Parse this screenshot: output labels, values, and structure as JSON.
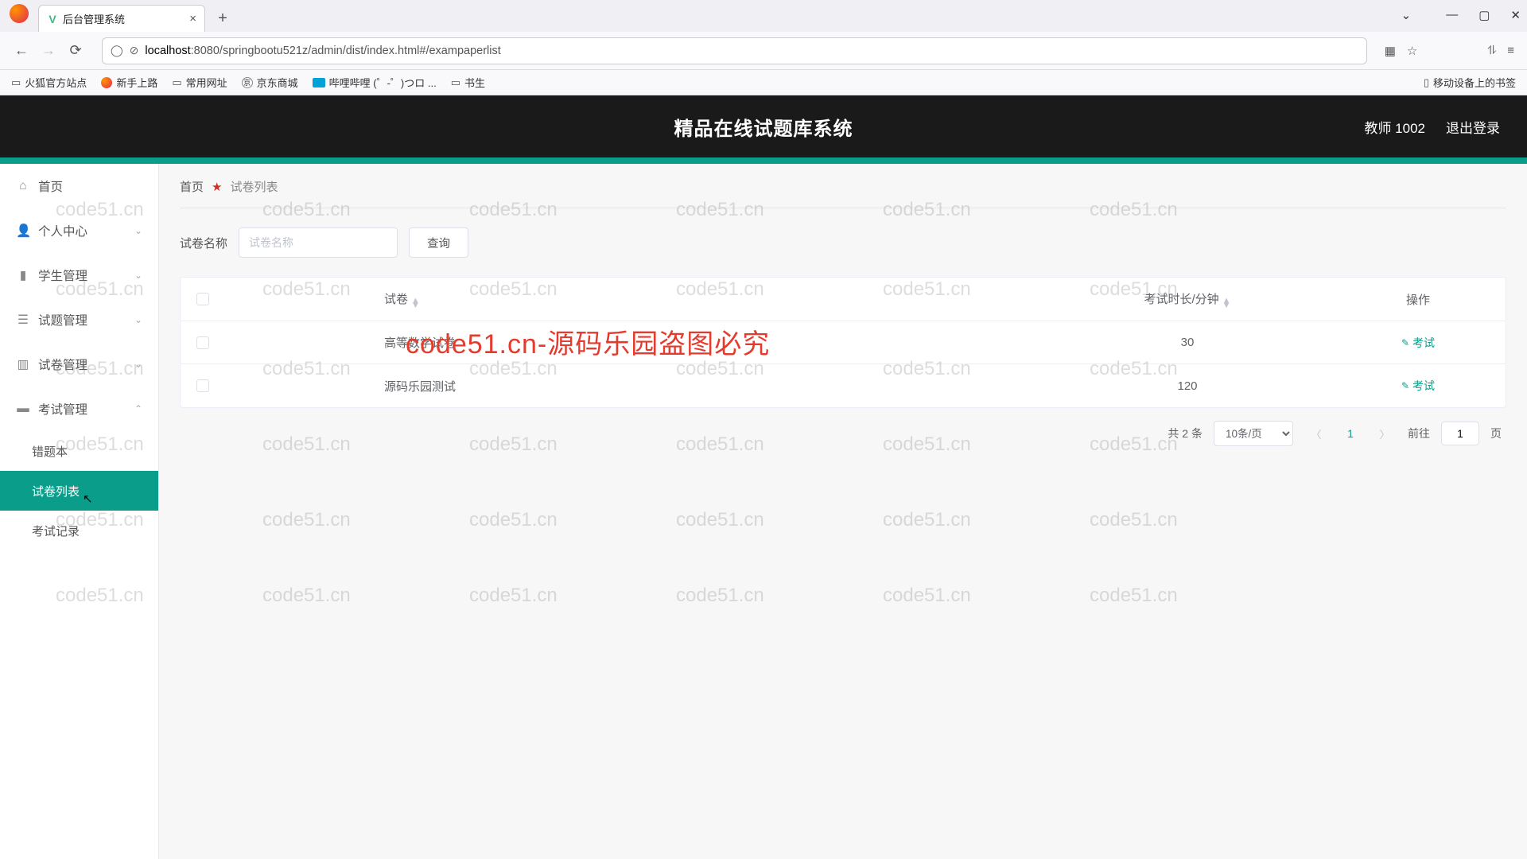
{
  "browser": {
    "tab_title": "后台管理系统",
    "url_host": "localhost",
    "url_path": ":8080/springbootu521z/admin/dist/index.html#/exampaperlist",
    "bookmarks": [
      "火狐官方站点",
      "新手上路",
      "常用网址",
      "京东商城",
      "哔哩哔哩 (゜-゜)つロ ...",
      "书生"
    ],
    "mobile_bm": "移动设备上的书签"
  },
  "header": {
    "title": "精品在线试题库系统",
    "user": "教师 1002",
    "logout": "退出登录"
  },
  "sidebar": {
    "items": [
      {
        "label": "首页"
      },
      {
        "label": "个人中心"
      },
      {
        "label": "学生管理"
      },
      {
        "label": "试题管理"
      },
      {
        "label": "试卷管理"
      },
      {
        "label": "考试管理"
      }
    ],
    "sub": [
      {
        "label": "错题本"
      },
      {
        "label": "试卷列表"
      },
      {
        "label": "考试记录"
      }
    ]
  },
  "crumb": {
    "home": "首页",
    "current": "试卷列表"
  },
  "search": {
    "label": "试卷名称",
    "placeholder": "试卷名称",
    "button": "查询"
  },
  "table": {
    "cols": {
      "name": "试卷",
      "duration": "考试时长/分钟",
      "op": "操作"
    },
    "rows": [
      {
        "name": "高等数学试卷",
        "duration": "30",
        "op": "考试"
      },
      {
        "name": "源码乐园测试",
        "duration": "120",
        "op": "考试"
      }
    ]
  },
  "pager": {
    "total": "共 2 条",
    "pagesize": "10条/页",
    "current": "1",
    "goto_pre": "前往",
    "goto_val": "1",
    "goto_suf": "页"
  },
  "watermark": {
    "text": "code51.cn",
    "red": "code51.cn-源码乐园盗图必究"
  }
}
